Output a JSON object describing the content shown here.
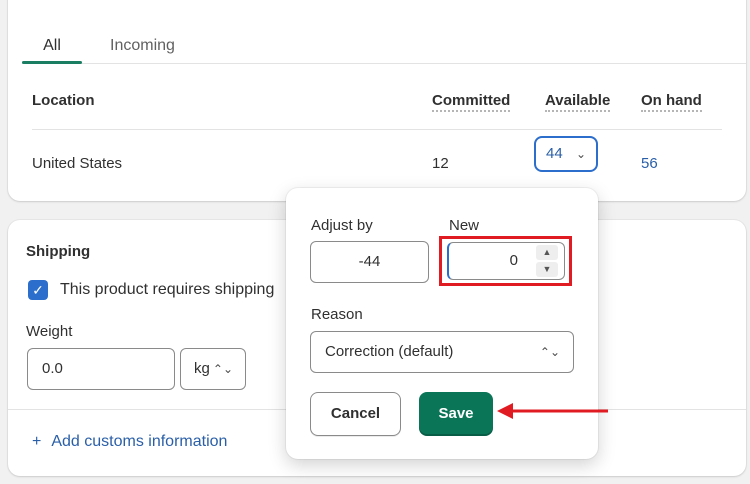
{
  "tabs": {
    "all": "All",
    "incoming": "Incoming"
  },
  "table": {
    "headers": {
      "location": "Location",
      "committed": "Committed",
      "available": "Available",
      "on_hand": "On hand"
    },
    "row": {
      "location": "United States",
      "committed": "12",
      "available": "44",
      "on_hand": "56"
    }
  },
  "shipping": {
    "title": "Shipping",
    "requires_shipping_label": "This product requires shipping",
    "requires_shipping_checked": true,
    "weight_label": "Weight",
    "weight_value": "0.0",
    "weight_unit": "kg",
    "add_customs_label": "Add customs information"
  },
  "popover": {
    "adjust_by_label": "Adjust by",
    "adjust_by_value": "-44",
    "new_label": "New",
    "new_value": "0",
    "reason_label": "Reason",
    "reason_value": "Correction (default)",
    "cancel_label": "Cancel",
    "save_label": "Save"
  },
  "colors": {
    "accent": "#0b7558",
    "link": "#2a5fa8",
    "focus": "#2c6ecb",
    "annotation": "#e11b22"
  },
  "icons": {
    "checkbox": "check-icon",
    "chevron": "chevron-down-icon",
    "select": "select-arrows-icon",
    "plus": "plus-icon",
    "spin_up": "caret-up-icon",
    "spin_down": "caret-down-icon"
  }
}
